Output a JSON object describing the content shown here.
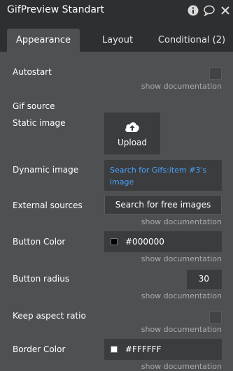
{
  "header": {
    "title": "GifPreview Standart"
  },
  "tabs": [
    {
      "label": "Appearance",
      "active": true
    },
    {
      "label": "Layout"
    },
    {
      "label": "Conditional (2)"
    }
  ],
  "icons": {
    "info": "info-icon",
    "comment": "comment-bubble-icon",
    "close": "close-icon",
    "upload": "cloud-upload-icon"
  },
  "show_documentation": "show documentation",
  "fields": {
    "autostart": {
      "label": "Autostart",
      "checked": false
    },
    "gif_source": {
      "label": "Gif source"
    },
    "static_image": {
      "label": "Static image",
      "button": "Upload"
    },
    "dynamic_image": {
      "label": "Dynamic image",
      "value": "Search for Gifs:item #3's image"
    },
    "external_sources": {
      "label": "External sources",
      "button": "Search for free images"
    },
    "button_color": {
      "label": "Button Color",
      "value": "#000000",
      "swatch": "#000000"
    },
    "button_radius": {
      "label": "Button radius",
      "value": "30"
    },
    "keep_aspect_ratio": {
      "label": "Keep aspect ratio",
      "checked": false
    },
    "border_color": {
      "label": "Border Color",
      "value": "#FFFFFF",
      "swatch": "#FFFFFF"
    }
  },
  "colors": {
    "link": "#4aa3ff",
    "panel": "#4f5052",
    "header": "#2e2f30",
    "field": "#3b3c3d"
  }
}
